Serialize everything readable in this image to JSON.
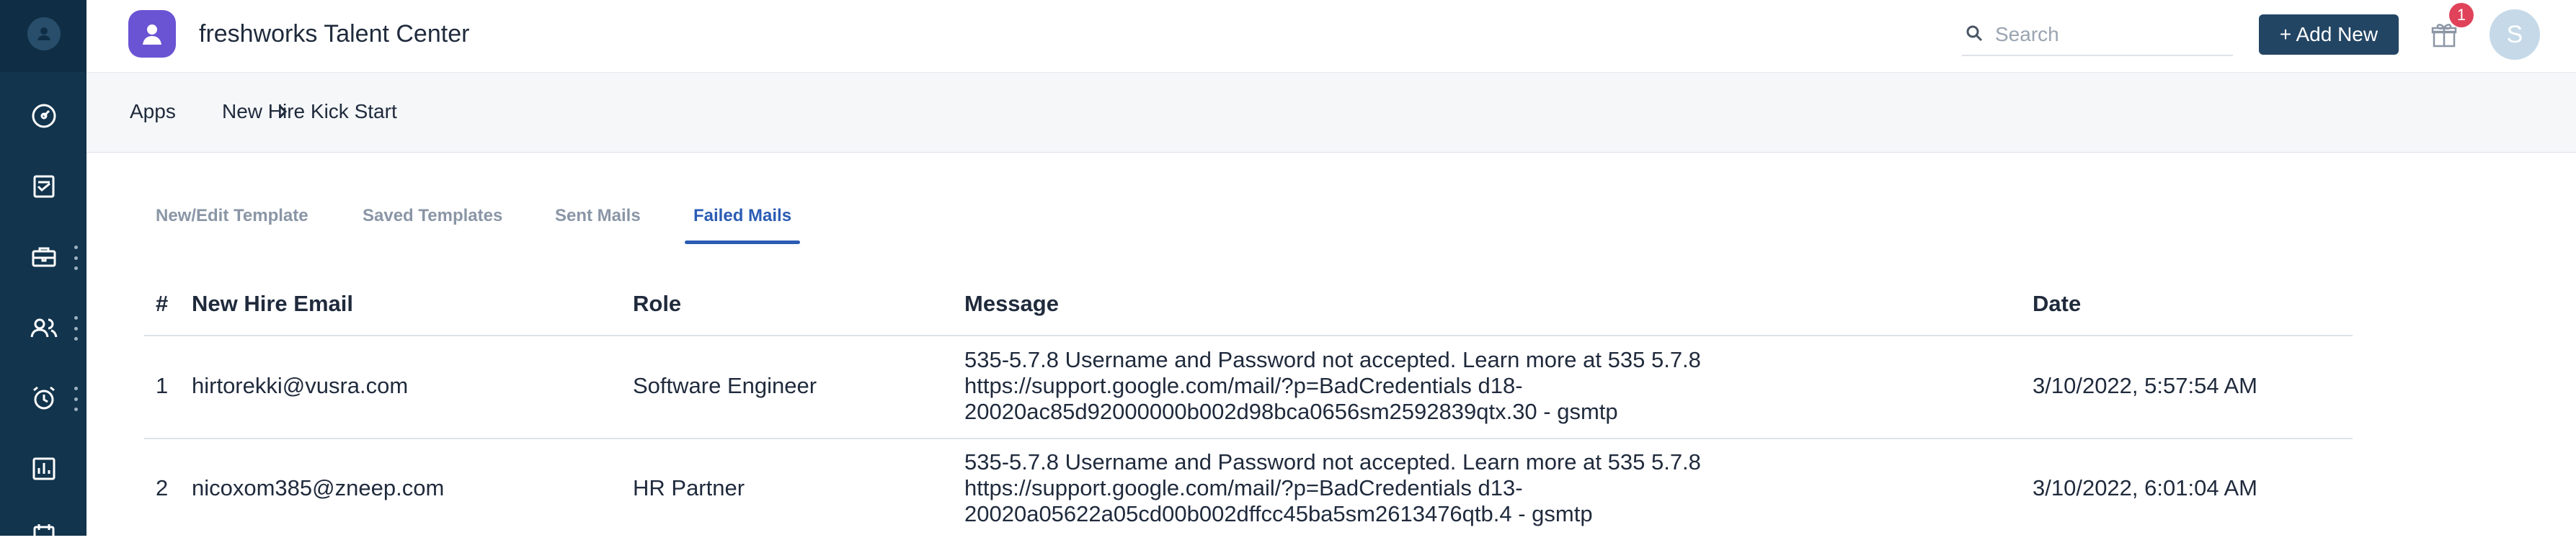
{
  "app": {
    "title": "freshworks Talent Center"
  },
  "search": {
    "placeholder": "Search"
  },
  "header": {
    "add_new_label": "+ Add New",
    "gift_badge": "1",
    "avatar_initial": "S"
  },
  "breadcrumb": {
    "root": "Apps",
    "current": "New Hire Kick Start"
  },
  "tabs": [
    {
      "label": "New/Edit Template",
      "active": false
    },
    {
      "label": "Saved Templates",
      "active": false
    },
    {
      "label": "Sent Mails",
      "active": false
    },
    {
      "label": "Failed Mails",
      "active": true
    }
  ],
  "table": {
    "columns": [
      "#",
      "New Hire Email",
      "Role",
      "Message",
      "Date"
    ],
    "rows": [
      {
        "num": "1",
        "email": "hirtorekki@vusra.com",
        "role": "Software Engineer",
        "message_lines": [
          "535-5.7.8 Username and Password not accepted. Learn more at 535 5.7.8",
          "https://support.google.com/mail/?p=BadCredentials d18-",
          "20020ac85d92000000b002d98bca0656sm2592839qtx.30 - gsmtp"
        ],
        "date": "3/10/2022, 5:57:54 AM"
      },
      {
        "num": "2",
        "email": "nicoxom385@zneep.com",
        "role": "HR Partner",
        "message_lines": [
          "535-5.7.8 Username and Password not accepted. Learn more at 535 5.7.8",
          "https://support.google.com/mail/?p=BadCredentials d13-",
          "20020a05622a05cd00b002dffcc45ba5sm2613476qtb.4 - gsmtp"
        ],
        "date": "3/10/2022, 6:01:04 AM"
      }
    ]
  }
}
